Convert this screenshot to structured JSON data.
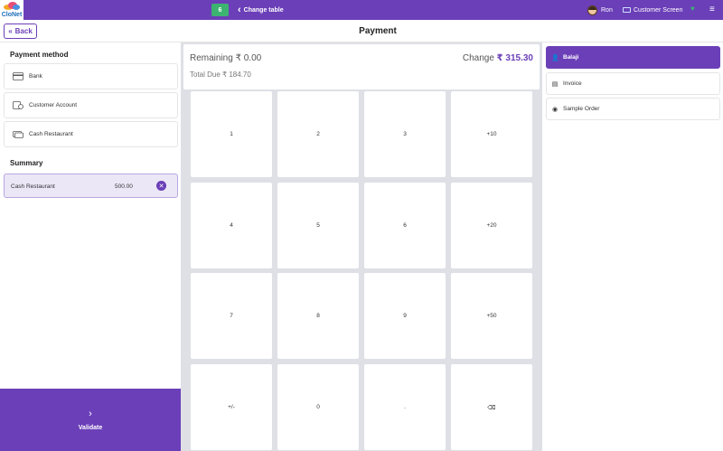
{
  "topbar": {
    "logo_text": "CloNet",
    "table_number": "6",
    "change_table_label": "Change table",
    "user_name": "Ron",
    "customer_screen_label": "Customer Screen"
  },
  "header": {
    "back_label": "Back",
    "title": "Payment"
  },
  "payment_methods": {
    "title": "Payment method",
    "items": [
      {
        "label": "Bank",
        "icon": "bank-card-icon"
      },
      {
        "label": "Customer Account",
        "icon": "customer-account-icon"
      },
      {
        "label": "Cash Restaurant",
        "icon": "cash-icon"
      }
    ]
  },
  "summary": {
    "title": "Summary",
    "lines": [
      {
        "method": "Cash Restaurant",
        "amount": "500.00"
      }
    ]
  },
  "validate_label": "Validate",
  "totals": {
    "remaining_label": "Remaining",
    "remaining_value": "₹ 0.00",
    "total_due_label": "Total Due",
    "total_due_value": "₹ 184.70",
    "change_label": "Change",
    "change_value": "₹ 315.30"
  },
  "keypad": [
    [
      "1",
      "2",
      "3",
      "+10"
    ],
    [
      "4",
      "5",
      "6",
      "+20"
    ],
    [
      "7",
      "8",
      "9",
      "+50"
    ],
    [
      "+/-",
      "0",
      ".",
      "⌫"
    ]
  ],
  "right_panel": {
    "items": [
      {
        "label": "Balaji",
        "icon": "user-icon",
        "active": true
      },
      {
        "label": "Invoice",
        "icon": "invoice-icon",
        "active": false
      },
      {
        "label": "Sample Order",
        "icon": "eye-icon",
        "active": false
      }
    ]
  },
  "colors": {
    "brand": "#6b3fb8",
    "table_badge": "#3cb371",
    "summary_bg": "#ece7f7"
  }
}
